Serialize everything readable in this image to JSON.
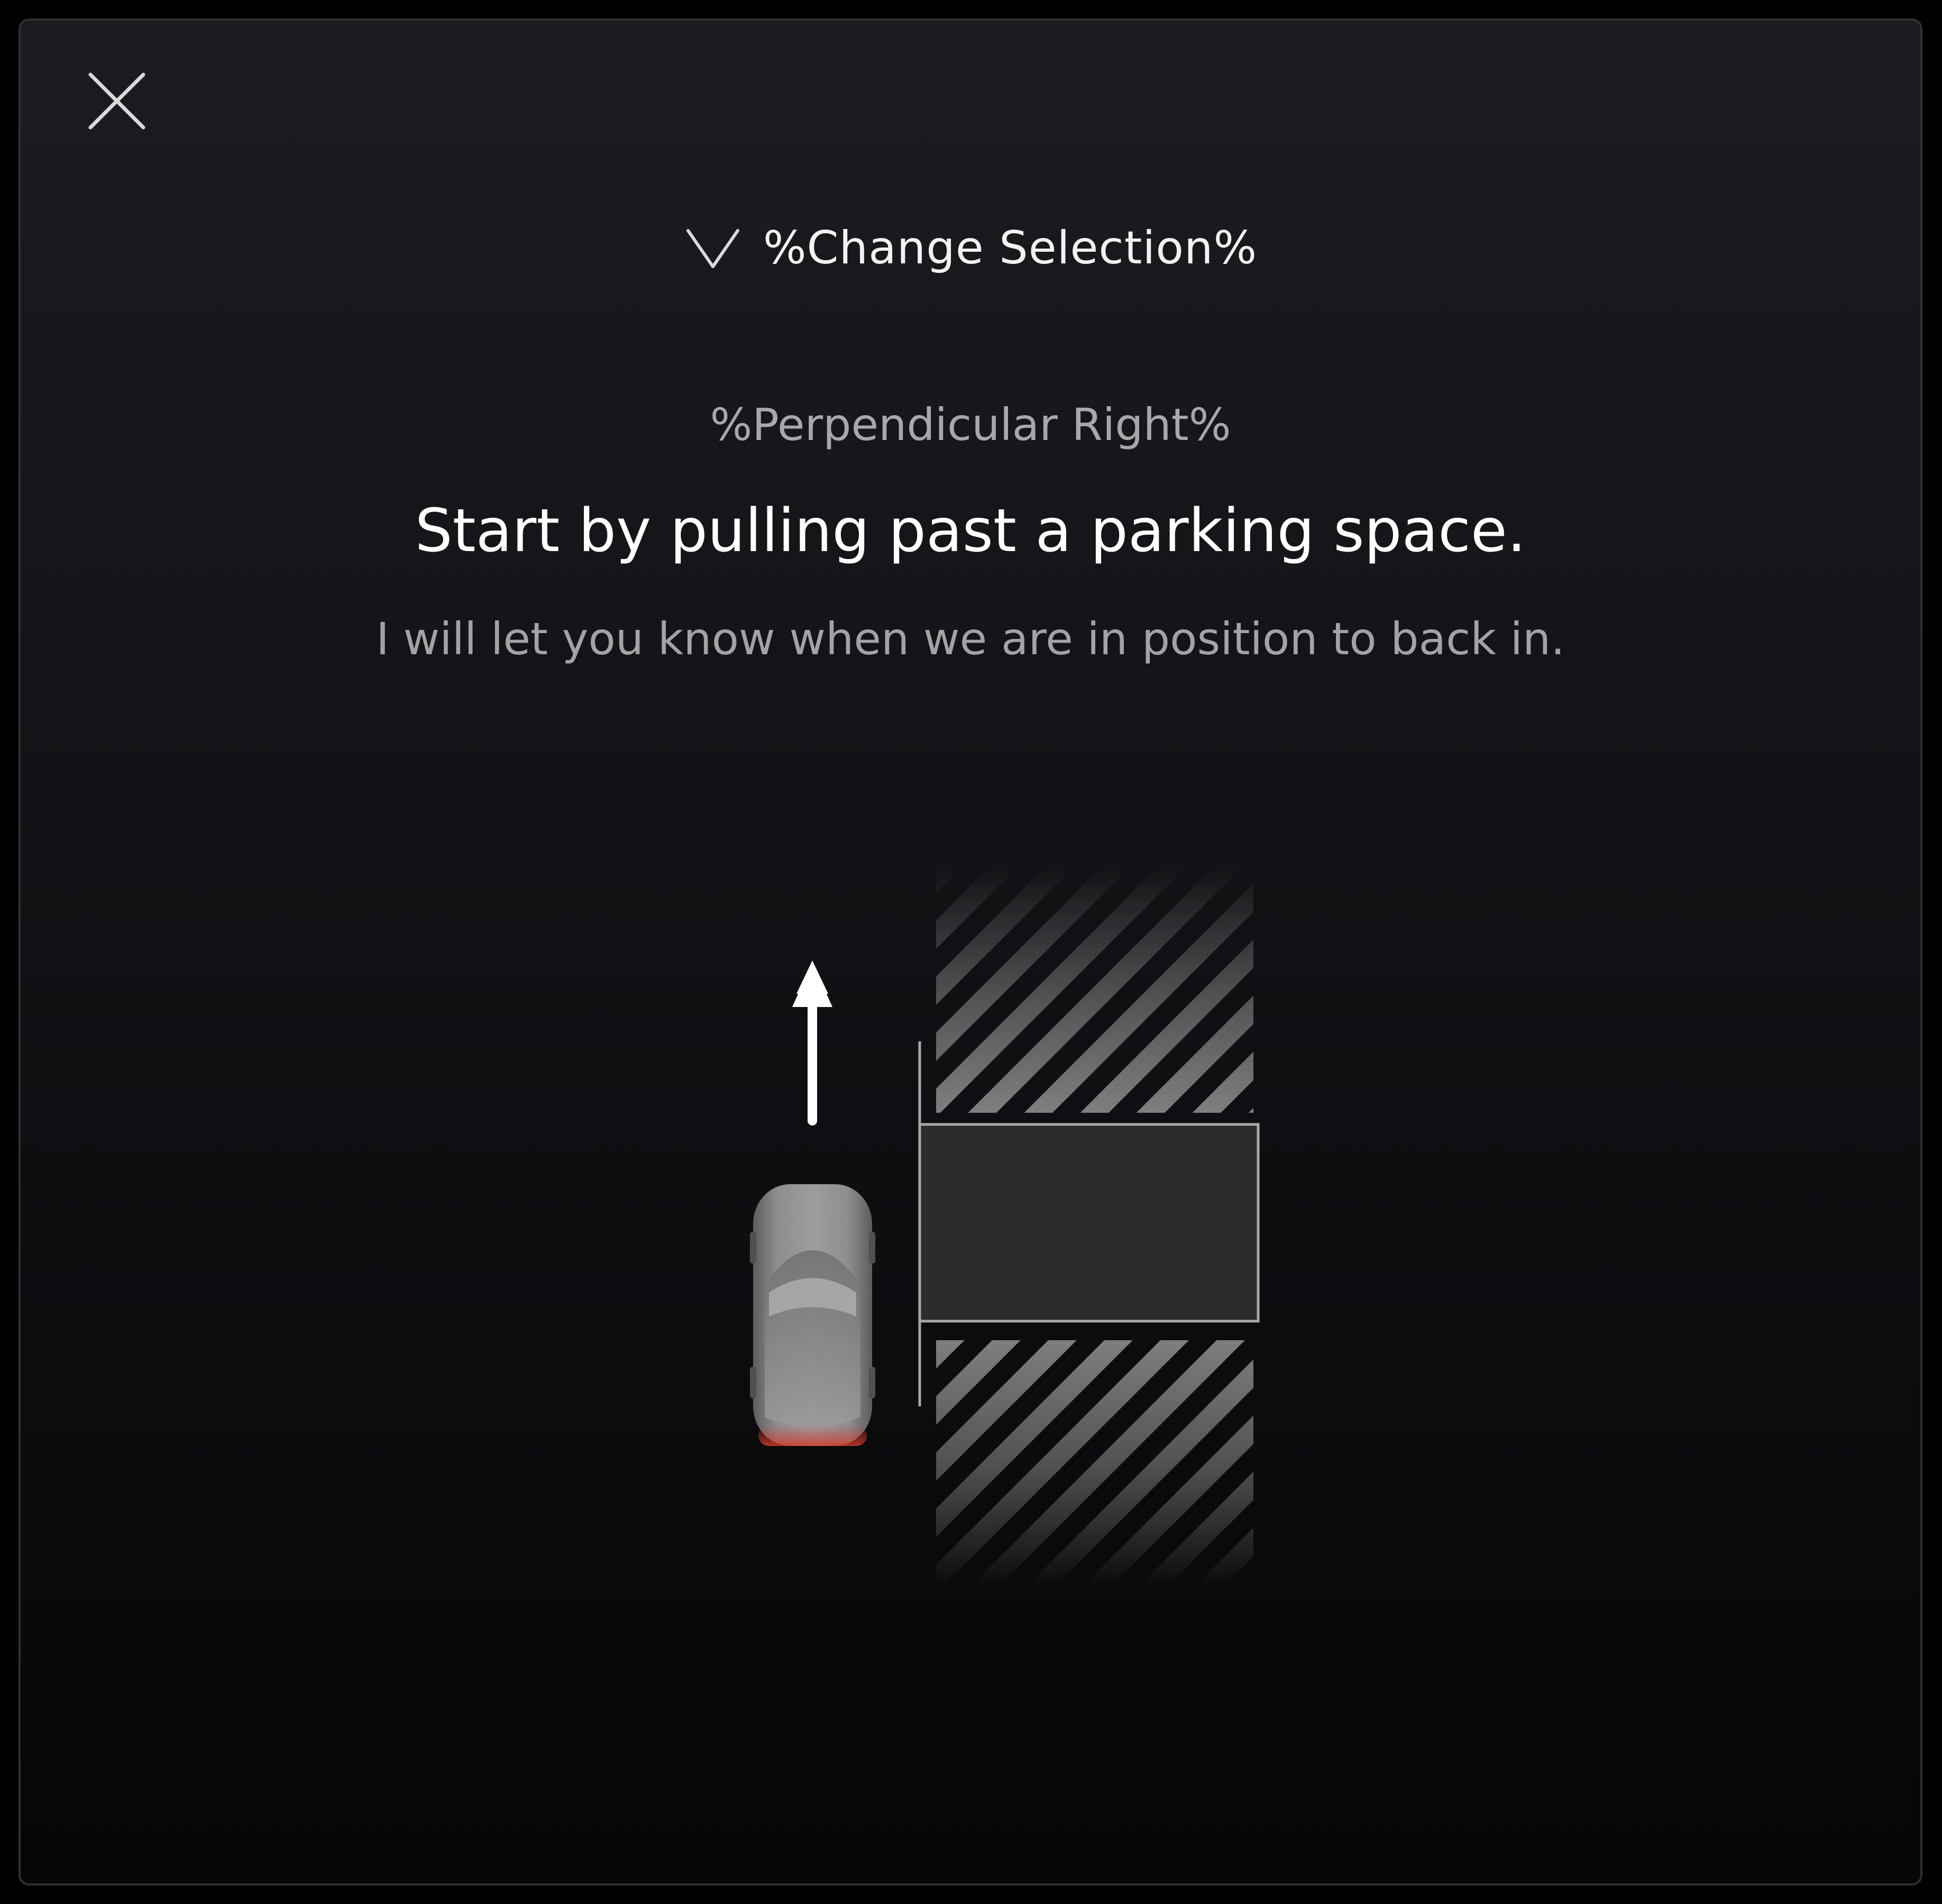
{
  "window": {
    "close_icon": "close-icon"
  },
  "selector": {
    "icon": "chevron-down-icon",
    "label": "%Change Selection%"
  },
  "parking": {
    "mode": "%Perpendicular Right%",
    "instruction": "Start by pulling past a parking space.",
    "sub_instruction": "I will let you know when we are in position to back in."
  },
  "illustration": {
    "arrow_icon": "arrow-up-icon",
    "vehicle_icon": "car-top-view-icon",
    "occupied_space_pattern": "hatched",
    "colors": {
      "background_top": "#1b1c20",
      "background_bottom": "#060608",
      "target_space_fill": "#2b2c2e",
      "target_space_border": "#a9a9ab",
      "car_body": "#8f8f91",
      "tail_light": "#d13a2a",
      "arrow": "#ffffff"
    }
  }
}
